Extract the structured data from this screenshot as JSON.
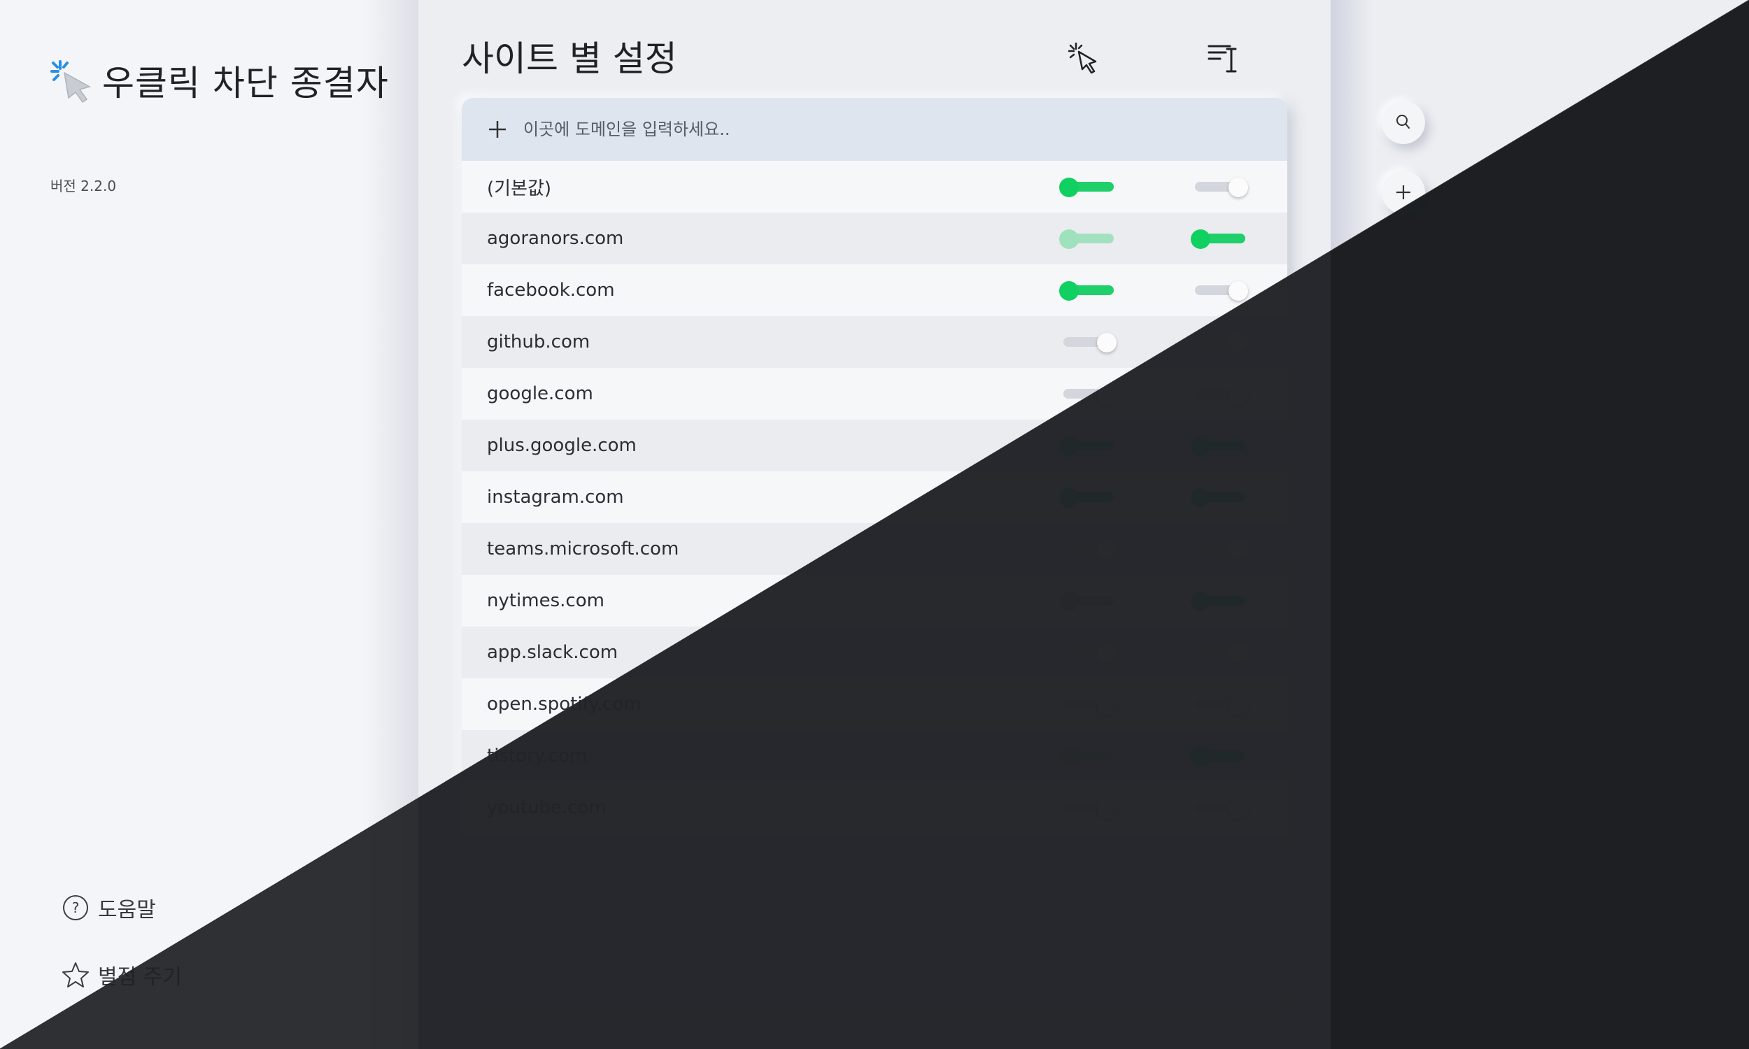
{
  "app": {
    "title": "우클릭 차단 종결자",
    "version": "버전 2.2.0"
  },
  "sidebar": {
    "help_label": "도움말",
    "rate_label": "별점 주기"
  },
  "main": {
    "title": "사이트 별 설정",
    "columns": [
      "right-click-icon",
      "text-select-icon"
    ],
    "add_placeholder": "이곳에 도메인을 입력하세요..",
    "sites": [
      {
        "domain": "(기본값)",
        "right_click": true,
        "text_select": false
      },
      {
        "domain": "agoranors.com",
        "right_click": true,
        "text_select": true,
        "right_click_disabled": true
      },
      {
        "domain": "facebook.com",
        "right_click": true,
        "text_select": false
      },
      {
        "domain": "github.com",
        "right_click": false,
        "text_select": false
      },
      {
        "domain": "google.com",
        "right_click": false,
        "text_select": false
      },
      {
        "domain": "plus.google.com",
        "right_click": true,
        "text_select": true
      },
      {
        "domain": "instagram.com",
        "right_click": true,
        "text_select": true
      },
      {
        "domain": "teams.microsoft.com",
        "right_click": false,
        "text_select": false
      },
      {
        "domain": "nytimes.com",
        "right_click": true,
        "text_select": true,
        "right_click_disabled": true
      },
      {
        "domain": "app.slack.com",
        "right_click": false,
        "text_select": false
      },
      {
        "domain": "open.spotify.com",
        "right_click": false,
        "text_select": false
      },
      {
        "domain": "tistory.com",
        "right_click": true,
        "text_select": true,
        "right_click_disabled": true
      },
      {
        "domain": "youtube.com",
        "right_click": false,
        "text_select": false
      }
    ]
  },
  "rail": {
    "buttons": [
      "search-icon",
      "plus-icon"
    ]
  },
  "colors": {
    "accent_green": "#0fd060",
    "dark_bg": "#1f2024",
    "logo_blue": "#2a8fe0"
  }
}
